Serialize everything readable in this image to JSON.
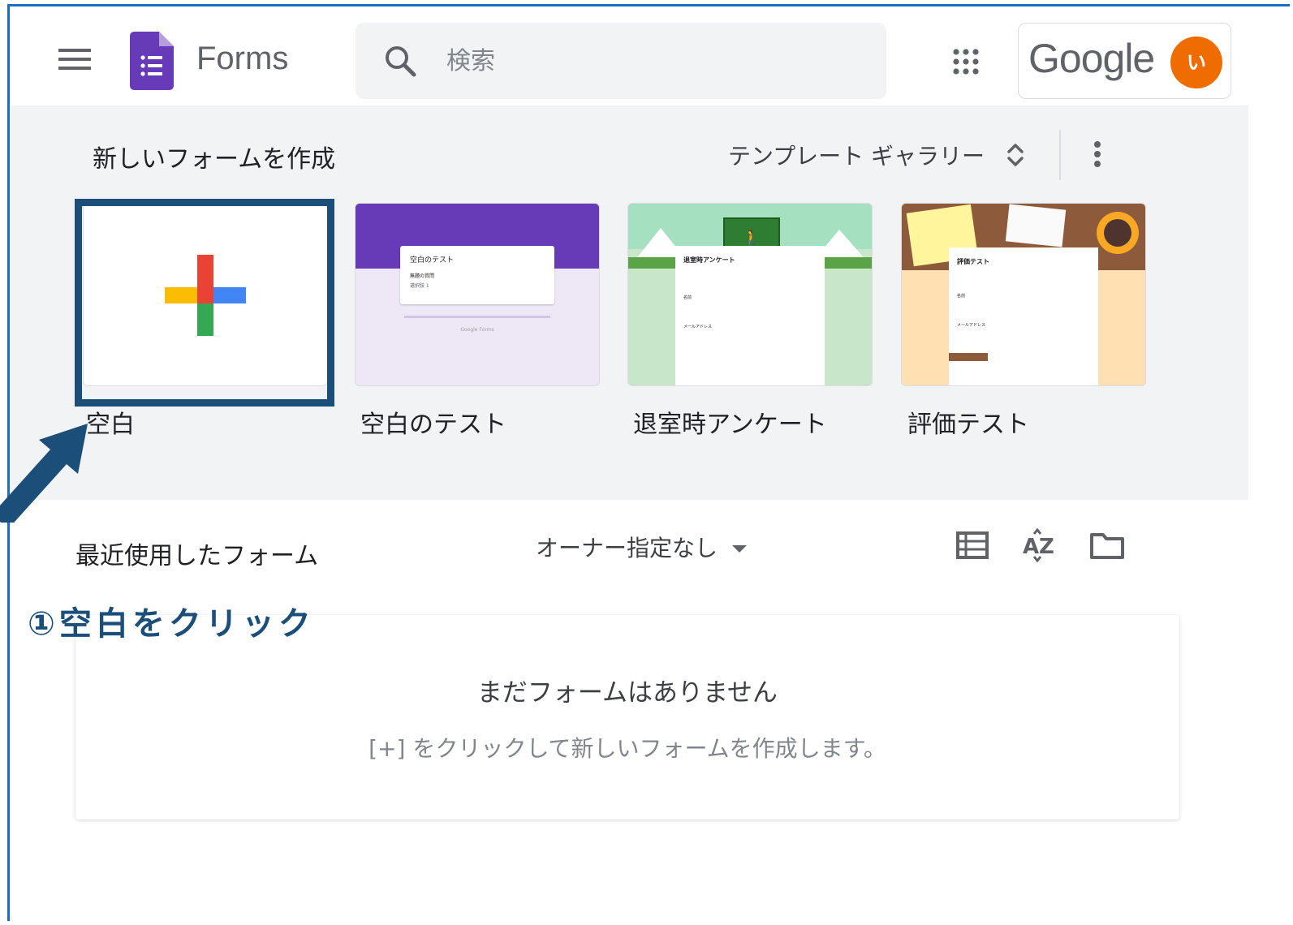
{
  "header": {
    "app_title": "Forms",
    "search_placeholder": "検索",
    "account_brand": "Google",
    "avatar_initial": "い"
  },
  "template_section": {
    "title": "新しいフォームを作成",
    "gallery_label": "テンプレート ギャラリー",
    "templates": [
      {
        "label": "空白"
      },
      {
        "label": "空白のテスト",
        "preview_title": "空白のテスト",
        "preview_question": "無題の質問",
        "preview_option": "選択肢 1",
        "preview_footer": "Google Forms"
      },
      {
        "label": "退室時アンケート",
        "preview_title": "退室時アンケート",
        "preview_field1": "名前",
        "preview_field2": "メールアドレス"
      },
      {
        "label": "評価テスト",
        "preview_title": "評価テスト",
        "preview_field1": "名前",
        "preview_field2": "メールアドレス"
      }
    ]
  },
  "recent_section": {
    "title": "最近使用したフォーム",
    "owner_filter": "オーナー指定なし",
    "empty_title": "まだフォームはありません",
    "empty_subtitle": "[+] をクリックして新しいフォームを作成します。"
  },
  "annotation": {
    "text": "①空白をクリック"
  },
  "colors": {
    "forms_purple": "#673ab7",
    "annotation_blue": "#1b4f7a",
    "avatar_orange": "#ef6c00"
  }
}
